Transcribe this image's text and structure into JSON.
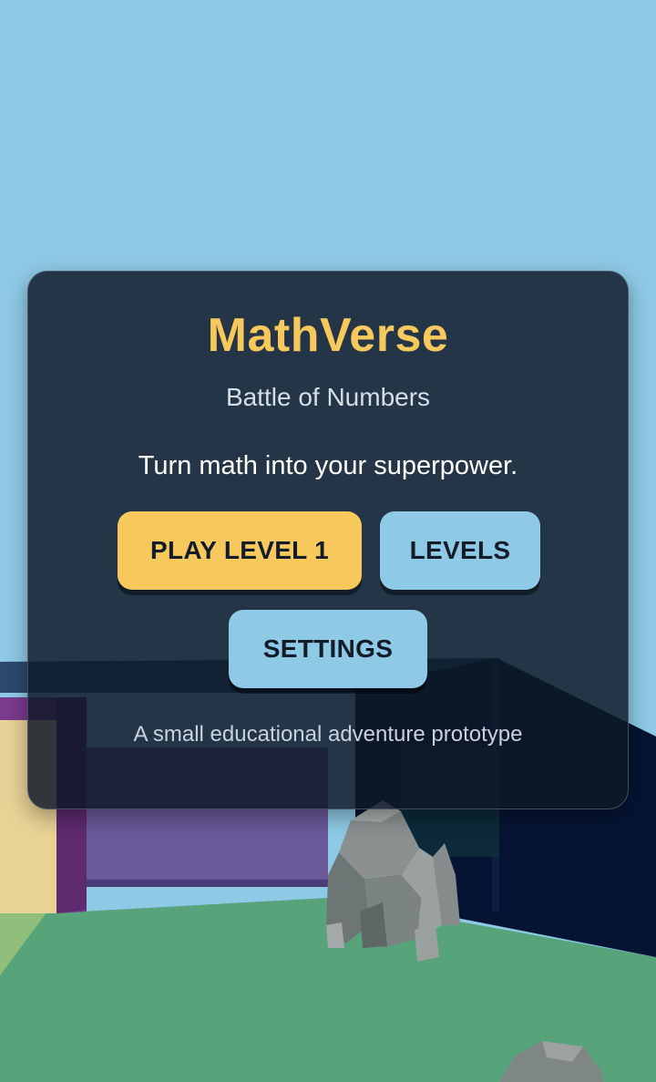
{
  "menu": {
    "title": "MathVerse",
    "subtitle": "Battle of Numbers",
    "tagline": "Turn math into your superpower.",
    "play_label": "PLAY LEVEL 1",
    "levels_label": "LEVELS",
    "settings_label": "SETTINGS",
    "footer_note": "A small educational adventure prototype"
  },
  "colors": {
    "sky": "#8ecae6",
    "ground": "#57a37a",
    "accent_yellow": "#f7c95c",
    "accent_blue": "#8ecae6",
    "panel": "#0e1828"
  }
}
